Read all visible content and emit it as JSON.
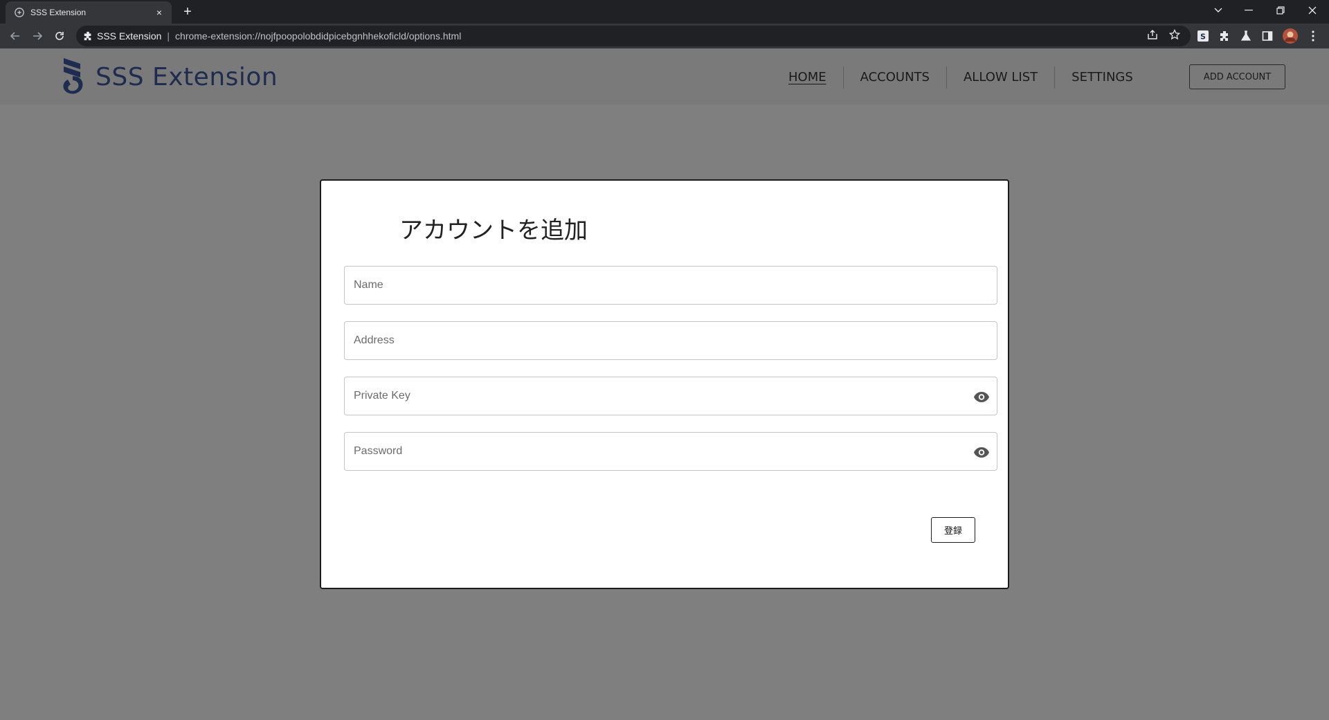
{
  "browser": {
    "tab_title": "SSS Extension",
    "tab_close_glyph": "×",
    "new_tab_glyph": "+",
    "site_chip": "SSS Extension",
    "url": "chrome-extension://nojfpoopolobdidpicebgnhhekoficld/options.html",
    "icons": [
      "back-arrow-icon",
      "forward-arrow-icon",
      "reload-icon",
      "puzzle-icon",
      "share-icon",
      "star-icon",
      "sss-extension-icon",
      "extensions-icon",
      "flask-icon",
      "side-panel-icon",
      "profile-avatar",
      "menu-kebab-icon",
      "tab-search-icon",
      "minimize-icon",
      "restore-icon",
      "close-window-icon"
    ]
  },
  "header": {
    "brand": "SSS Extension",
    "nav": [
      {
        "label": "HOME",
        "active": true
      },
      {
        "label": "ACCOUNTS",
        "active": false
      },
      {
        "label": "ALLOW LIST",
        "active": false
      },
      {
        "label": "SETTINGS",
        "active": false
      }
    ],
    "add_account_label": "ADD ACCOUNT"
  },
  "modal": {
    "title": "アカウントを追加",
    "fields": {
      "name": {
        "placeholder": "Name",
        "value": ""
      },
      "address": {
        "placeholder": "Address",
        "value": ""
      },
      "private_key": {
        "placeholder": "Private Key",
        "value": ""
      },
      "password": {
        "placeholder": "Password",
        "value": ""
      }
    },
    "submit_label": "登録"
  },
  "colors": {
    "overlay_bg": "#7f7f7f",
    "brand_navy": "#1e2d4f",
    "modal_bg": "#ffffff",
    "chrome_dark": "#202124",
    "chrome_toolbar": "#35363a"
  }
}
